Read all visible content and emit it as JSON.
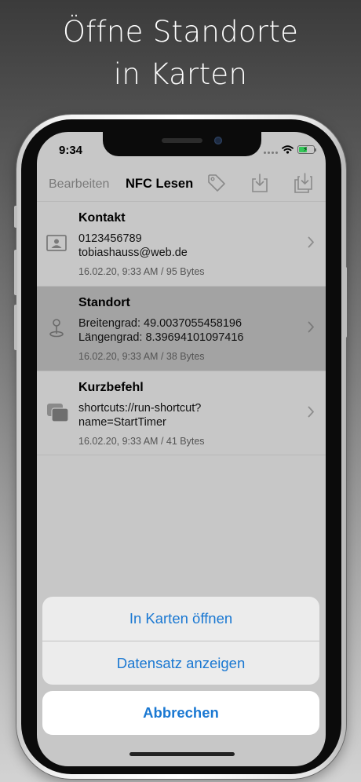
{
  "headline": {
    "line1": "Öffne Standorte",
    "line2": "in Karten"
  },
  "status_bar": {
    "time": "9:34",
    "battery_level": 0.55
  },
  "navbar": {
    "edit_label": "Bearbeiten",
    "title": "NFC Lesen",
    "icons": [
      "tag-icon",
      "download-icon",
      "import-icon"
    ]
  },
  "records": [
    {
      "title": "Kontakt",
      "line1": "0123456789",
      "line2": "tobiashauss@web.de",
      "meta": "16.02.20, 9:33 AM / 95 Bytes",
      "icon": "contact-card-icon",
      "selected": false
    },
    {
      "title": "Standort",
      "line1": "Breitengrad: 49.0037055458196",
      "line2": "Längengrad: 8.39694101097416",
      "meta": "16.02.20, 9:33 AM / 38 Bytes",
      "icon": "map-pin-icon",
      "selected": true
    },
    {
      "title": "Kurzbefehl",
      "line1": "shortcuts://run-shortcut?",
      "line2": "name=StartTimer",
      "meta": "16.02.20, 9:33 AM / 41 Bytes",
      "icon": "shortcut-stack-icon",
      "selected": false
    }
  ],
  "action_sheet": {
    "open_in_maps": "In Karten öffnen",
    "show_record": "Datensatz anzeigen",
    "cancel": "Abbrechen"
  },
  "colors": {
    "accent": "#1a78d2",
    "battery": "#34c759",
    "selected_row": "#a3a3a3"
  }
}
